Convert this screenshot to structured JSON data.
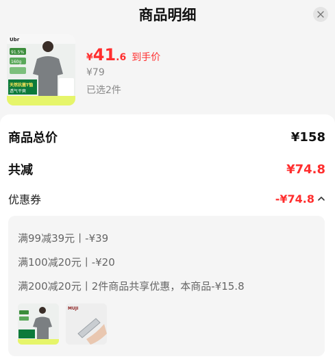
{
  "header": {
    "title": "商品明细"
  },
  "product": {
    "badge_brand": "Ubr",
    "badge_pct": "91.5%",
    "badge_weight": "160g",
    "badge_feature": "天然抗菌T恤",
    "badge_feature2": "透气干爽",
    "price_yen": "¥",
    "price_int": "41",
    "price_dec": ".6",
    "price_tag": "到手价",
    "original_price": "¥79",
    "selected_text": "已选2件"
  },
  "summary": {
    "total_label": "商品总价",
    "total_value": "¥158",
    "discount_label": "共减",
    "discount_value": "¥74.8",
    "coupon_label": "优惠券",
    "coupon_value": "-¥74.8"
  },
  "coupons": {
    "rules": [
      "满99减39元丨-¥39",
      "满100减20元丨-¥20",
      "满200减20元丨2件商品共享优惠，本商品-¥15.8"
    ],
    "thumb2_brand": "MUJI"
  },
  "colors": {
    "accent": "#ff2e2e",
    "text": "#222222",
    "muted": "#888888"
  }
}
